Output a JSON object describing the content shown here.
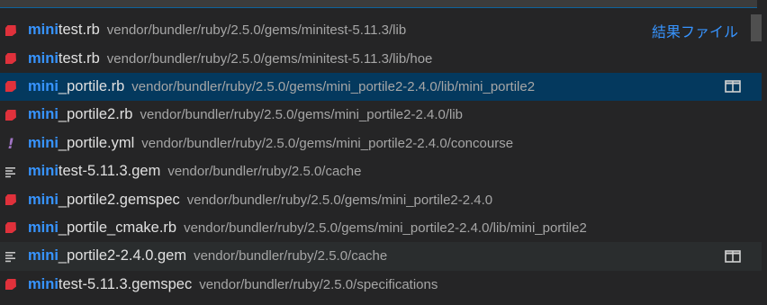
{
  "quick_open": {
    "result_label": "結果ファイル",
    "split_icon": "split-editor-icon",
    "results": [
      {
        "highlight": "mini",
        "rest": "test.rb",
        "path": "vendor/bundler/ruby/2.5.0/gems/minitest-5.11.3/lib",
        "icon": "ruby-icon",
        "state": "normal",
        "show_label": true,
        "show_split": false
      },
      {
        "highlight": "mini",
        "rest": "test.rb",
        "path": "vendor/bundler/ruby/2.5.0/gems/minitest-5.11.3/lib/hoe",
        "icon": "ruby-icon",
        "state": "normal",
        "show_label": false,
        "show_split": false
      },
      {
        "highlight": "mini",
        "rest": "_portile.rb",
        "path": "vendor/bundler/ruby/2.5.0/gems/mini_portile2-2.4.0/lib/mini_portile2",
        "icon": "ruby-icon",
        "state": "selected",
        "show_label": false,
        "show_split": true
      },
      {
        "highlight": "mini",
        "rest": "_portile2.rb",
        "path": "vendor/bundler/ruby/2.5.0/gems/mini_portile2-2.4.0/lib",
        "icon": "ruby-icon",
        "state": "normal",
        "show_label": false,
        "show_split": false
      },
      {
        "highlight": "mini",
        "rest": "_portile.yml",
        "path": "vendor/bundler/ruby/2.5.0/gems/mini_portile2-2.4.0/concourse",
        "icon": "yaml-icon",
        "state": "normal",
        "show_label": false,
        "show_split": false
      },
      {
        "highlight": "mini",
        "rest": "test-5.11.3.gem",
        "path": "vendor/bundler/ruby/2.5.0/cache",
        "icon": "file-lines-icon",
        "state": "normal",
        "show_label": false,
        "show_split": false
      },
      {
        "highlight": "mini",
        "rest": "_portile2.gemspec",
        "path": "vendor/bundler/ruby/2.5.0/gems/mini_portile2-2.4.0",
        "icon": "ruby-icon",
        "state": "normal",
        "show_label": false,
        "show_split": false
      },
      {
        "highlight": "mini",
        "rest": "_portile_cmake.rb",
        "path": "vendor/bundler/ruby/2.5.0/gems/mini_portile2-2.4.0/lib/mini_portile2",
        "icon": "ruby-icon",
        "state": "normal",
        "show_label": false,
        "show_split": false
      },
      {
        "highlight": "mini",
        "rest": "_portile2-2.4.0.gem",
        "path": "vendor/bundler/ruby/2.5.0/cache",
        "icon": "file-lines-icon",
        "state": "hovered",
        "show_label": false,
        "show_split": true
      },
      {
        "highlight": "mini",
        "rest": "test-5.11.3.gemspec",
        "path": "vendor/bundler/ruby/2.5.0/specifications",
        "icon": "ruby-icon",
        "state": "normal",
        "show_label": false,
        "show_split": false
      }
    ]
  },
  "colors": {
    "background": "#252526",
    "selected_row": "#04395e",
    "hovered_row": "#2a2d2e",
    "match_highlight": "#3794ff",
    "ruby_icon": "#e0313b",
    "yaml_icon": "#a074c4",
    "path_text": "#a6a6a6"
  }
}
